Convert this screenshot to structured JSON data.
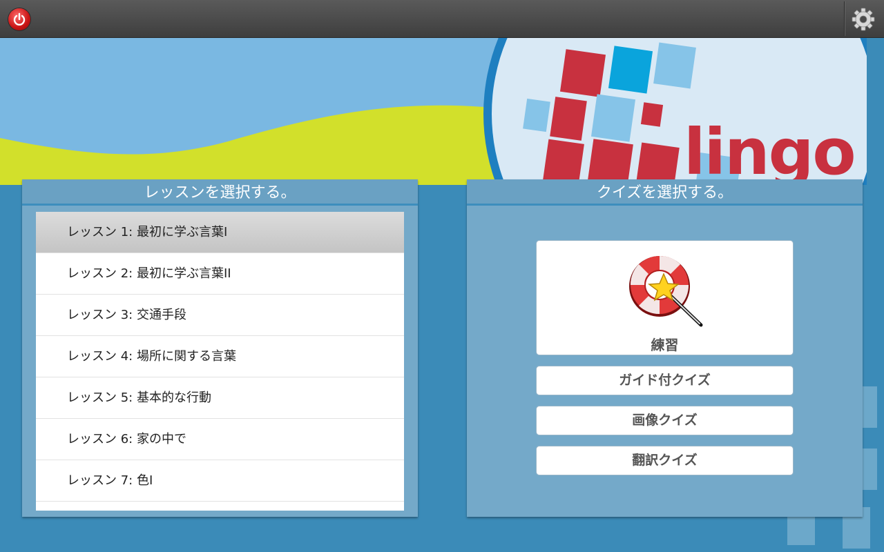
{
  "topbar": {
    "power_icon": "power-icon",
    "settings_icon": "gear-icon"
  },
  "banner": {
    "logo_text": "lingo"
  },
  "lessons": {
    "header": "レッスンを選択する。",
    "items": [
      {
        "label": "レッスン 1: 最初に学ぶ言葉I",
        "selected": true
      },
      {
        "label": "レッスン 2: 最初に学ぶ言葉II",
        "selected": false
      },
      {
        "label": "レッスン 3: 交通手段",
        "selected": false
      },
      {
        "label": "レッスン 4: 場所に関する言葉",
        "selected": false
      },
      {
        "label": "レッスン 5: 基本的な行動",
        "selected": false
      },
      {
        "label": "レッスン 6: 家の中で",
        "selected": false
      },
      {
        "label": "レッスン 7: 色I",
        "selected": false
      }
    ]
  },
  "quiz": {
    "header": "クイズを選択する。",
    "practice_label": "練習",
    "practice_icon": "lifebuoy-magic-wand-icon",
    "guided_label": "ガイド付クイズ",
    "image_label": "画像クイズ",
    "translation_label": "翻訳クイズ"
  },
  "colors": {
    "background": "#3b8bb8",
    "topbar": "#4a4a4a",
    "banner_sky": "#7ab8e2",
    "banner_wave": "#d2e02b",
    "logo_red": "#c8313f",
    "panel": "#74a9c9"
  }
}
